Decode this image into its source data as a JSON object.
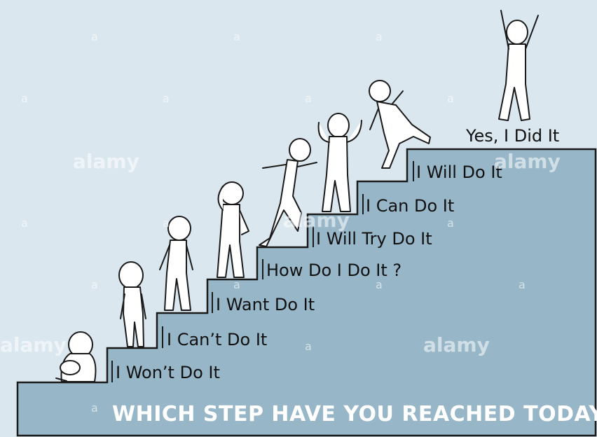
{
  "steps": [
    {
      "label": "I Won’t Do It"
    },
    {
      "label": "I Can’t Do It"
    },
    {
      "label": "I Want Do It"
    },
    {
      "label": "How Do I Do It ?"
    },
    {
      "label": "I Will Try Do It"
    },
    {
      "label": "I Can Do It"
    },
    {
      "label": "I Will Do It"
    },
    {
      "label": "Yes, I Did It"
    }
  ],
  "caption": {
    "text": "WHICH STEP HAVE YOU REACHED TODAY?"
  },
  "watermark": {
    "brand": "alamy",
    "mark": "a"
  },
  "colors": {
    "sky": "#dbe7ee",
    "stairs": "#97b6c8",
    "outline": "#1a1a1a",
    "caption": "#ffffff"
  }
}
